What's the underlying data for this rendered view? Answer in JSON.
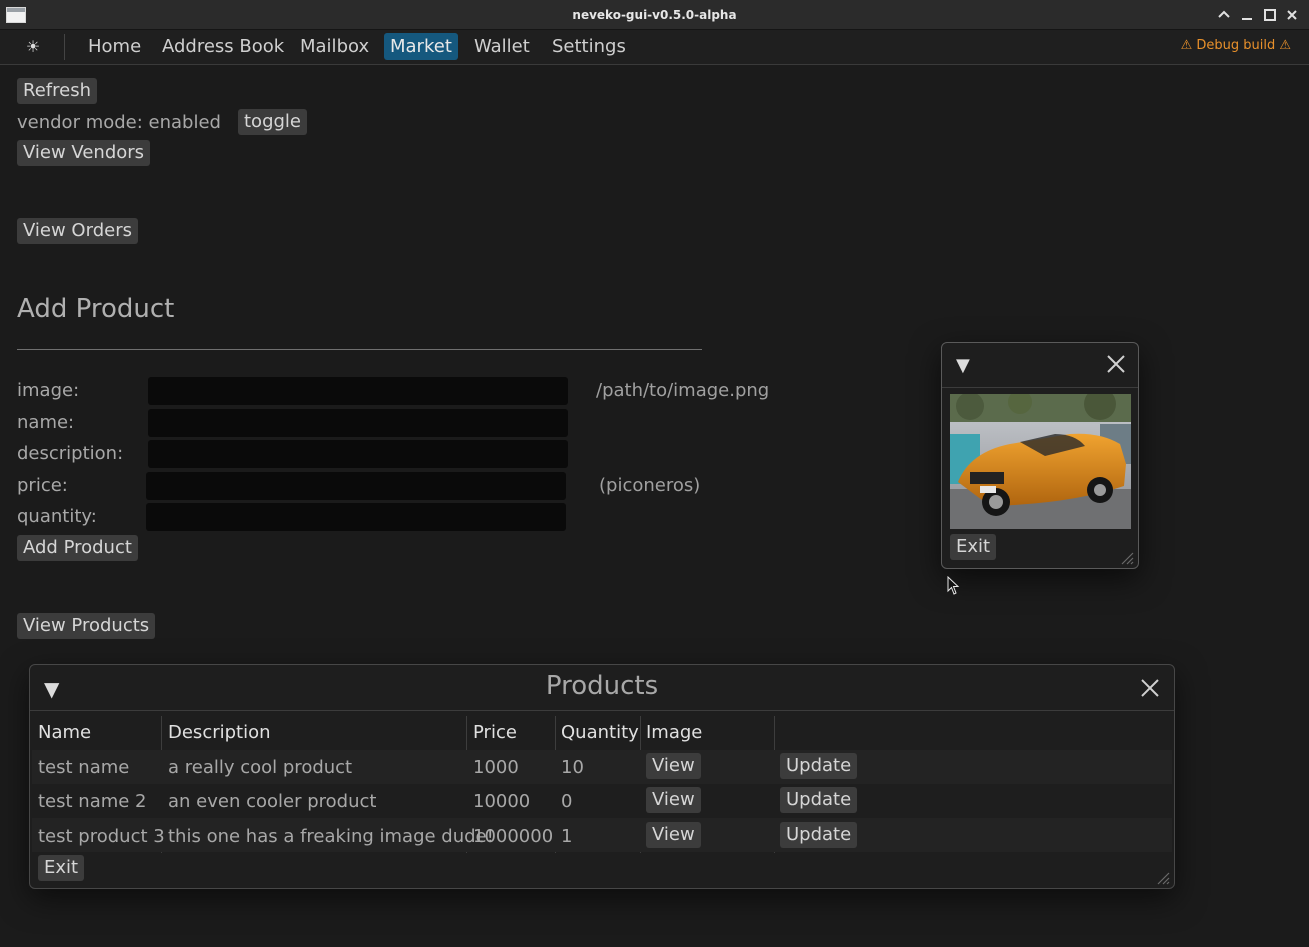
{
  "window": {
    "title": "neveko-gui-v0.5.0-alpha",
    "icon": "window-icon",
    "controls": [
      "chevron-up-icon",
      "minimize-icon",
      "maximize-icon",
      "close-icon"
    ]
  },
  "menubar": {
    "theme_icon": "☀",
    "items": [
      "Home",
      "Address Book",
      "Mailbox",
      "Market",
      "Wallet",
      "Settings"
    ],
    "active": "Market",
    "debug_label": "⚠ Debug build ⚠"
  },
  "market": {
    "refresh": "Refresh",
    "vendor_mode": "vendor mode: enabled",
    "toggle": "toggle",
    "view_vendors": "View Vendors",
    "view_orders": "View Orders",
    "add_product_heading": "Add Product",
    "form": {
      "image_label": "image:",
      "image_hint": "/path/to/image.png",
      "name_label": "name:",
      "description_label": "description:",
      "price_label": "price:",
      "price_hint": "(piconeros)",
      "quantity_label": "quantity:",
      "image_value": "",
      "name_value": "",
      "description_value": "",
      "price_value": "",
      "quantity_value": ""
    },
    "add_product_button": "Add Product",
    "view_products": "View Products"
  },
  "image_window": {
    "exit": "Exit"
  },
  "products_window": {
    "title": "Products",
    "columns": [
      "Name",
      "Description",
      "Price",
      "Quantity",
      "Image"
    ],
    "rows": [
      {
        "name": "test name",
        "description": "a really cool product",
        "price": "1000",
        "quantity": "10",
        "view": "View",
        "update": "Update"
      },
      {
        "name": "test name 2",
        "description": "an even cooler product",
        "price": "10000",
        "quantity": "0",
        "view": "View",
        "update": "Update"
      },
      {
        "name": "test product 3",
        "description": "this one has a freaking image dude!",
        "price": "1000000",
        "quantity": "1",
        "view": "View",
        "update": "Update"
      }
    ],
    "exit": "Exit"
  },
  "colors": {
    "background": "#1b1b1b",
    "accent": "#15587e",
    "warning": "#e8902b"
  }
}
